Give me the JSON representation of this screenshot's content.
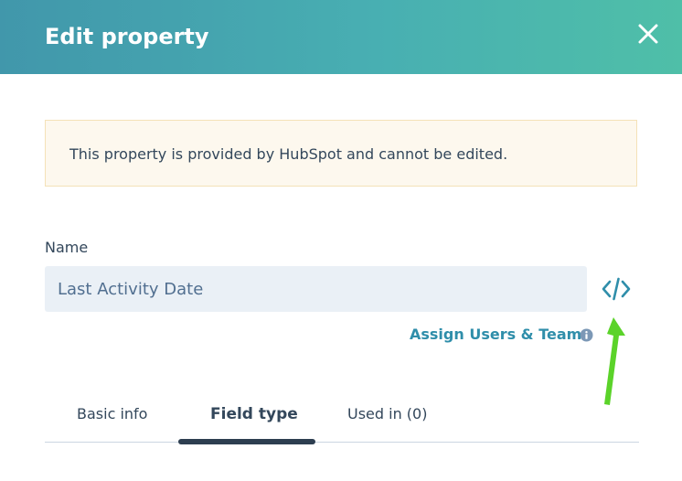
{
  "header": {
    "title": "Edit property",
    "close_icon": "close-icon"
  },
  "notice": {
    "text": "This property is provided by HubSpot and cannot be edited."
  },
  "name_field": {
    "label": "Name",
    "value": "Last Activity Date",
    "code_icon": "code-icon"
  },
  "assign": {
    "label": "Assign Users & Teams",
    "info_icon": "info-icon"
  },
  "tabs": [
    {
      "label": "Basic info",
      "active": false
    },
    {
      "label": "Field type",
      "active": true
    },
    {
      "label": "Used in (0)",
      "active": false
    }
  ],
  "colors": {
    "header_gradient_start": "#4197ab",
    "header_gradient_end": "#4fbfa8",
    "link": "#2f8eaa",
    "notice_bg": "#fdf8ee",
    "notice_border": "#f4e2b8",
    "input_bg": "#eaf0f6",
    "text": "#33475b",
    "annotation_arrow": "#5bd32a"
  }
}
